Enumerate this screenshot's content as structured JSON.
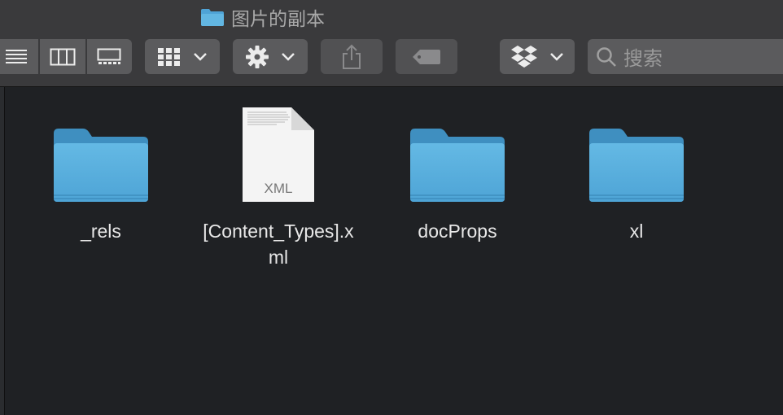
{
  "window": {
    "title": "图片的副本",
    "title_icon": "folder-icon"
  },
  "toolbar": {
    "view_buttons": [
      {
        "name": "list-view",
        "icon": "list-icon"
      },
      {
        "name": "column-view",
        "icon": "columns-icon"
      },
      {
        "name": "gallery-view",
        "icon": "gallery-icon"
      }
    ],
    "group_button_icon": "grid-icon",
    "action_button_icon": "gear-icon",
    "share_button_icon": "share-icon",
    "tag_button_icon": "tag-icon",
    "dropbox_button_icon": "dropbox-icon"
  },
  "search": {
    "placeholder": "搜索"
  },
  "files": [
    {
      "label": "_rels",
      "kind": "folder"
    },
    {
      "label": "[Content_Types].xml",
      "kind": "xml",
      "badge": "XML"
    },
    {
      "label": "docProps",
      "kind": "folder"
    },
    {
      "label": "xl",
      "kind": "folder"
    }
  ],
  "colors": {
    "background": "#1f2124",
    "toolbar": "#3a3a3c",
    "button": "#5b5b5d",
    "folder": "#5ab0dc"
  }
}
